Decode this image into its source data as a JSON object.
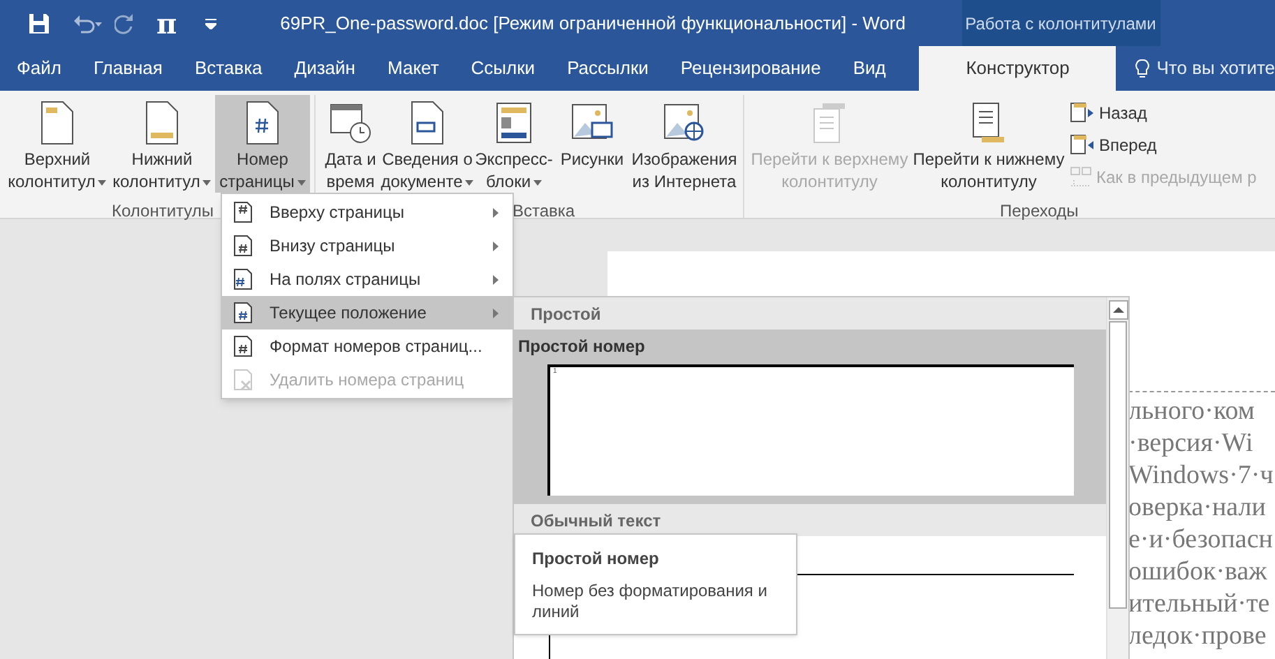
{
  "title_bar": {
    "title": "69PR_One-password.doc [Режим ограниченной функциональности] - Word",
    "context_header": "Работа с колонтитулами",
    "quick_access": [
      "π"
    ]
  },
  "tabs": [
    {
      "label": "Файл",
      "selected": false
    },
    {
      "label": "Главная",
      "selected": false
    },
    {
      "label": "Вставка",
      "selected": false
    },
    {
      "label": "Дизайн",
      "selected": false
    },
    {
      "label": "Макет",
      "selected": false
    },
    {
      "label": "Ссылки",
      "selected": false
    },
    {
      "label": "Рассылки",
      "selected": false
    },
    {
      "label": "Рецензирование",
      "selected": false
    },
    {
      "label": "Вид",
      "selected": false
    },
    {
      "label": "Конструктор",
      "selected": true
    }
  ],
  "tell_me": {
    "placeholder": "Что вы хотите"
  },
  "ribbon": {
    "groups": [
      {
        "label": "Колонтитулы",
        "buttons": [
          {
            "lines": [
              "Верхний",
              "колонтитул"
            ],
            "dropdown": true,
            "selected": false,
            "disabled": false
          },
          {
            "lines": [
              "Нижний",
              "колонтитул"
            ],
            "dropdown": true,
            "selected": false,
            "disabled": false
          },
          {
            "lines": [
              "Номер",
              "страницы"
            ],
            "dropdown": true,
            "selected": true,
            "disabled": false
          }
        ]
      },
      {
        "label": "Вставка",
        "buttons": [
          {
            "lines": [
              "Дата и",
              "время"
            ],
            "dropdown": false,
            "selected": false,
            "disabled": false
          },
          {
            "lines": [
              "Сведения о",
              "документе"
            ],
            "dropdown": true,
            "selected": false,
            "disabled": false
          },
          {
            "lines": [
              "Экспресс-",
              "блоки"
            ],
            "dropdown": true,
            "selected": false,
            "disabled": false
          },
          {
            "lines": [
              "Рисунки"
            ],
            "dropdown": false,
            "selected": false,
            "disabled": false
          },
          {
            "lines": [
              "Изображения",
              "из Интернета"
            ],
            "dropdown": false,
            "selected": false,
            "disabled": false
          }
        ]
      },
      {
        "label": "Переходы",
        "buttons": [
          {
            "lines": [
              "Перейти к верхнему",
              "колонтитулу"
            ],
            "dropdown": false,
            "selected": false,
            "disabled": true
          },
          {
            "lines": [
              "Перейти к нижнему",
              "колонтитулу"
            ],
            "dropdown": false,
            "selected": false,
            "disabled": false
          }
        ],
        "small_buttons": [
          {
            "label": "Назад",
            "disabled": false
          },
          {
            "label": "Вперед",
            "disabled": false
          },
          {
            "label": "Как в предыдущем р",
            "disabled": true
          }
        ]
      }
    ]
  },
  "menu": {
    "items": [
      {
        "label": "Вверху страницы",
        "submenu": true,
        "selected": false,
        "disabled": false
      },
      {
        "label": "Внизу страницы",
        "submenu": true,
        "selected": false,
        "disabled": false
      },
      {
        "label": "На полях страницы",
        "submenu": true,
        "selected": false,
        "disabled": false
      },
      {
        "label": "Текущее положение",
        "submenu": true,
        "selected": true,
        "disabled": false
      },
      {
        "label": "Формат номеров страниц...",
        "submenu": false,
        "selected": false,
        "disabled": false
      },
      {
        "label": "Удалить номера страниц",
        "submenu": false,
        "selected": false,
        "disabled": true
      }
    ]
  },
  "gallery": {
    "sections": [
      {
        "header": "Простой",
        "items": [
          {
            "title": "Простой номер",
            "selected": true,
            "preview_number": "1"
          }
        ]
      },
      {
        "header": "Обычный текст"
      }
    ]
  },
  "tooltip": {
    "title": "Простой номер",
    "text": "Номер без форматирования и линий"
  },
  "document": {
    "lines": [
      "льного·ком",
      "·версия·Wi",
      "Windows·7·ч",
      "оверка·нали",
      "е·и·безопасн",
      "ошибок·важ",
      "ительный·те",
      "ледок·прове"
    ]
  }
}
